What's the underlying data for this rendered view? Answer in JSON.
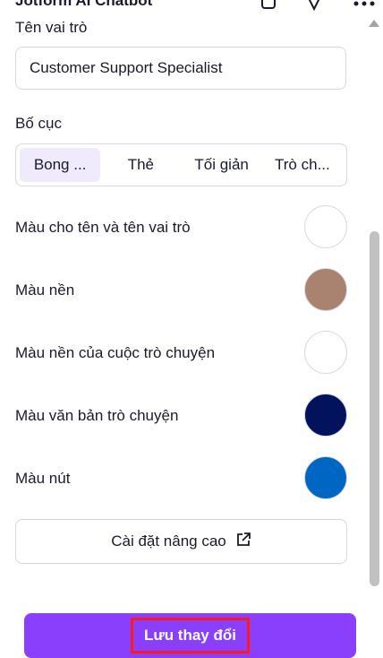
{
  "header": {
    "title": "Jotform AI Chatbot",
    "icons": [
      "copy-icon",
      "pin-icon",
      "more-icon"
    ]
  },
  "form": {
    "role_name_label": "Tên vai trò",
    "role_name_value": "Customer Support Specialist",
    "layout_label": "Bố cục",
    "layout_options": [
      {
        "label": "Bong ...",
        "selected": true
      },
      {
        "label": "Thẻ",
        "selected": false
      },
      {
        "label": "Tối giản",
        "selected": false
      },
      {
        "label": "Trò ch...",
        "selected": false
      }
    ],
    "colors": [
      {
        "label": "Màu cho tên và tên vai trò",
        "color": "#ffffff"
      },
      {
        "label": "Màu nền",
        "color": "#a98270"
      },
      {
        "label": "Màu nền của cuộc trò chuyện",
        "color": "#ffffff"
      },
      {
        "label": "Màu văn bản trò chuyện",
        "color": "#03125c"
      },
      {
        "label": "Màu nút",
        "color": "#0066c3"
      }
    ],
    "advanced_settings_label": "Cài đặt nâng cao"
  },
  "footer": {
    "save_label": "Lưu thay đổi",
    "save_color": "#8a3ffc"
  }
}
